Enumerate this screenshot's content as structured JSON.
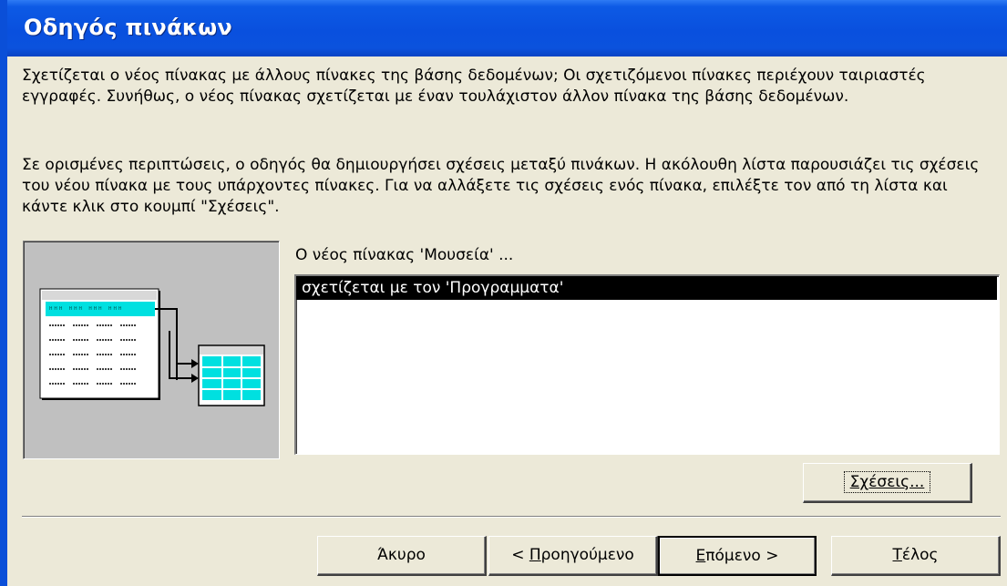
{
  "window": {
    "title": "Οδηγός πινάκων"
  },
  "intro": {
    "paragraph1": "Σχετίζεται ο νέος πίνακας με άλλους πίνακες της βάσης δεδομένων; Οι σχετιζόμενοι πίνακες περιέχουν ταιριαστές εγγραφές. Συνήθως, ο νέος πίνακας σχετίζεται με έναν τουλάχιστον άλλον πίνακα της βάσης δεδομένων.",
    "paragraph2": "Σε ορισμένες περιπτώσεις, ο οδηγός θα δημιουργήσει σχέσεις μεταξύ πινάκων. Η ακόλουθη λίστα παρουσιάζει τις σχέσεις του νέου πίνακα με τους υπάρχοντες πίνακες. Για να αλλάξετε τις σχέσεις ενός πίνακα, επιλέξτε τον από τη λίστα και κάντε κλικ στο κουμπί \"Σχέσεις\"."
  },
  "relations": {
    "caption": "Ο νέος πίνακας 'Μουσεία' ...",
    "items": [
      {
        "label": "σχετίζεται με τον 'Προγραμματα'",
        "selected": true
      }
    ],
    "button_label": "Σχέσεις..."
  },
  "footer": {
    "cancel_label": "Άκυρο",
    "back_label_prefix": "< ",
    "back_label_mnemonic": "Π",
    "back_label_rest": "ροηγούμενο",
    "next_label_mnemonic": "Ε",
    "next_label_rest": "πόμενο >",
    "finish_label_mnemonic": "Τ",
    "finish_label_rest": "έλος"
  },
  "colors": {
    "titlebar": "#0a4fd8",
    "dialog_bg": "#ece9d8",
    "selection_bg": "#000000",
    "table_header": "#00e0e0"
  }
}
